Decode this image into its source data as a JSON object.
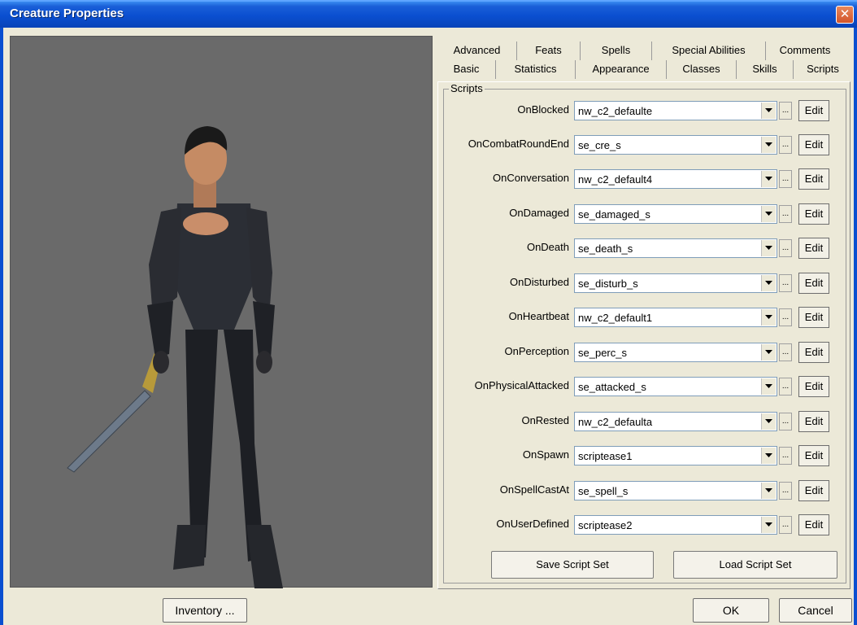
{
  "window": {
    "title": "Creature Properties"
  },
  "tabs": {
    "row1": [
      "Advanced",
      "Feats",
      "Spells",
      "Special Abilities",
      "Comments"
    ],
    "row2": [
      "Basic",
      "Statistics",
      "Appearance",
      "Classes",
      "Skills",
      "Scripts"
    ],
    "active": "Scripts"
  },
  "scripts": {
    "group_label": "Scripts",
    "rows": [
      {
        "label": "OnBlocked",
        "value": "nw_c2_defaulte"
      },
      {
        "label": "OnCombatRoundEnd",
        "value": "se_cre_s"
      },
      {
        "label": "OnConversation",
        "value": "nw_c2_default4"
      },
      {
        "label": "OnDamaged",
        "value": "se_damaged_s"
      },
      {
        "label": "OnDeath",
        "value": "se_death_s"
      },
      {
        "label": "OnDisturbed",
        "value": "se_disturb_s"
      },
      {
        "label": "OnHeartbeat",
        "value": "nw_c2_default1"
      },
      {
        "label": "OnPerception",
        "value": "se_perc_s"
      },
      {
        "label": "OnPhysicalAttacked",
        "value": "se_attacked_s"
      },
      {
        "label": "OnRested",
        "value": "nw_c2_defaulta"
      },
      {
        "label": "OnSpawn",
        "value": "scriptease1"
      },
      {
        "label": "OnSpellCastAt",
        "value": "se_spell_s"
      },
      {
        "label": "OnUserDefined",
        "value": "scriptease2"
      }
    ],
    "browse_label": "...",
    "edit_label": "Edit",
    "save_set_label": "Save Script Set",
    "load_set_label": "Load Script Set"
  },
  "buttons": {
    "inventory": "Inventory ...",
    "ok": "OK",
    "cancel": "Cancel"
  }
}
